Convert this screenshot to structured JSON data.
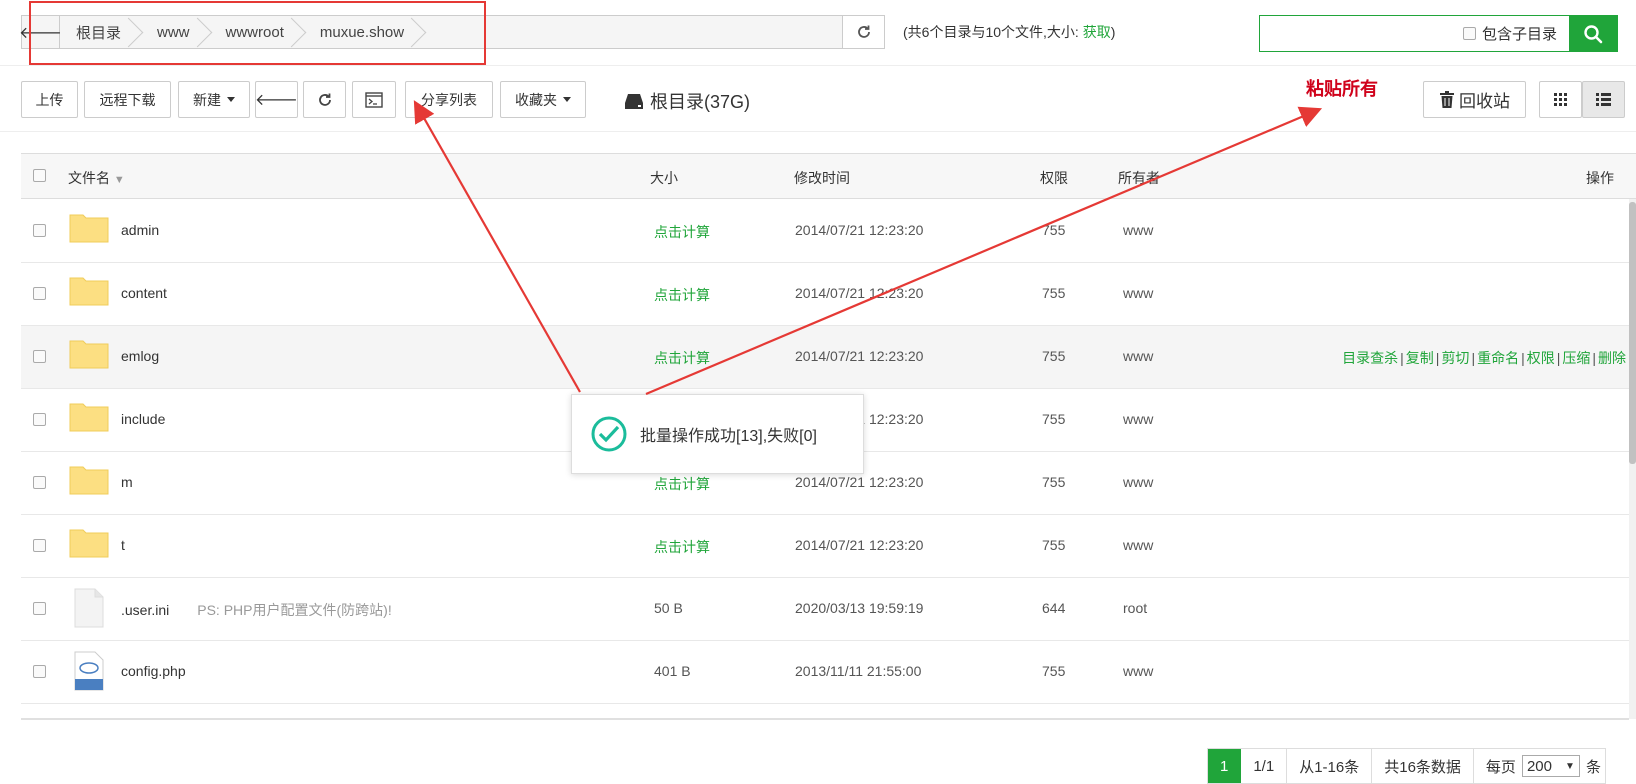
{
  "address_bar": {
    "crumbs": [
      "根目录",
      "www",
      "wwwroot",
      "muxue.show"
    ]
  },
  "dir_info": {
    "prefix": "(共6个目录与10个文件,大小: ",
    "link": "获取",
    "suffix": ")"
  },
  "search": {
    "placeholder": "",
    "include_sub_label": "包含子目录"
  },
  "toolbar": {
    "upload": "上传",
    "remote_download": "远程下载",
    "new": "新建",
    "share_list": "分享列表",
    "favorites": "收藏夹",
    "disk_label": "根目录(37G)",
    "recycle": "回收站"
  },
  "annotation": {
    "paste_all": "粘贴所有"
  },
  "table": {
    "headers": {
      "name": "文件名",
      "size": "大小",
      "mtime": "修改时间",
      "perm": "权限",
      "owner": "所有者",
      "ops": "操作"
    },
    "rows": [
      {
        "name": "admin",
        "type": "folder",
        "size": "点击计算",
        "mtime": "2014/07/21 12:23:20",
        "perm": "755",
        "owner": "www",
        "note": ""
      },
      {
        "name": "content",
        "type": "folder",
        "size": "点击计算",
        "mtime": "2014/07/21 12:23:20",
        "perm": "755",
        "owner": "www",
        "note": ""
      },
      {
        "name": "emlog",
        "type": "folder",
        "size": "点击计算",
        "mtime": "2014/07/21 12:23:20",
        "perm": "755",
        "owner": "www",
        "note": ""
      },
      {
        "name": "include",
        "type": "folder",
        "size": "",
        "mtime": "2014/07/21 12:23:20",
        "perm": "755",
        "owner": "www",
        "note": ""
      },
      {
        "name": "m",
        "type": "folder",
        "size": "点击计算",
        "mtime": "2014/07/21 12:23:20",
        "perm": "755",
        "owner": "www",
        "note": ""
      },
      {
        "name": "t",
        "type": "folder",
        "size": "点击计算",
        "mtime": "2014/07/21 12:23:20",
        "perm": "755",
        "owner": "www",
        "note": ""
      },
      {
        "name": ".user.ini",
        "type": "file",
        "size": "50 B",
        "mtime": "2020/03/13 19:59:19",
        "perm": "644",
        "owner": "root",
        "note": "PS: PHP用户配置文件(防跨站)!"
      },
      {
        "name": "config.php",
        "type": "php",
        "size": "401 B",
        "mtime": "2013/11/11 21:55:00",
        "perm": "755",
        "owner": "www",
        "note": ""
      }
    ],
    "hover_ops": [
      "目录查杀",
      "复制",
      "剪切",
      "重命名",
      "权限",
      "压缩",
      "删除"
    ]
  },
  "toast": {
    "message": "批量操作成功[13],失败[0]"
  },
  "pager": {
    "current": "1",
    "page_of": "1/1",
    "range": "从1-16条",
    "total": "共16条数据",
    "per_page_label": "每页",
    "per_page_value": "200",
    "per_page_unit": "条"
  },
  "colors": {
    "accent": "#20a53a",
    "annotation_red": "#d0021b"
  }
}
